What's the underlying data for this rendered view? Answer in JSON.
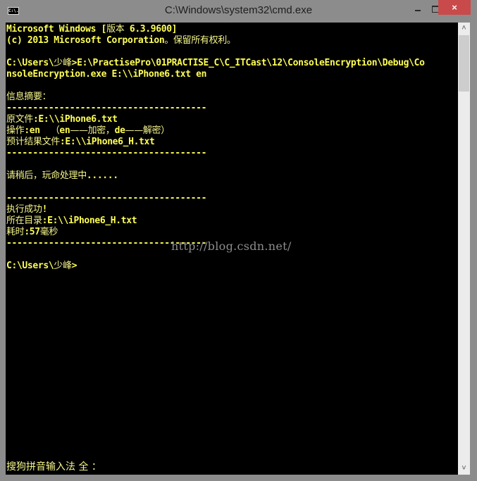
{
  "window": {
    "title": "C:\\Windows\\system32\\cmd.exe",
    "icon_label": "C:\\.",
    "icon": "cmd-icon",
    "controls": {
      "minimize": "minimize-icon",
      "maximize": "maximize-icon",
      "close": "×"
    }
  },
  "console": {
    "lines": [
      "Microsoft Windows [版本 6.3.9600]",
      "(c) 2013 Microsoft Corporation。保留所有权利。",
      "",
      "C:\\Users\\少峰>E:\\PractisePro\\01PRACTISE_C\\C_ITCast\\12\\ConsoleEncryption\\Debug\\Co",
      "nsoleEncryption.exe E:\\\\iPhone6.txt en",
      "",
      "信息摘要：",
      "--------------------------------------",
      "原文件:E:\\\\iPhone6.txt",
      "操作:en  （en——加密，de——解密）",
      "预计结果文件:E:\\\\iPhone6_H.txt",
      "--------------------------------------",
      "",
      "请稍后，玩命处理中......",
      "",
      "--------------------------------------",
      "执行成功!",
      "所在目录:E:\\\\iPhone6_H.txt",
      "耗时:57毫秒",
      "--------------------------------------",
      "",
      "C:\\Users\\少峰>"
    ],
    "watermark": "http://blog.csdn.net/",
    "ime_status": "搜狗拼音输入法 全 ："
  },
  "scrollbar": {
    "up": "˄",
    "down": "˅",
    "position_fraction": 0.0
  },
  "colors": {
    "console_bg": "#000000",
    "console_text": "#ffff55",
    "chrome": "#8c8c8c",
    "close_button": "#c94a4a"
  }
}
